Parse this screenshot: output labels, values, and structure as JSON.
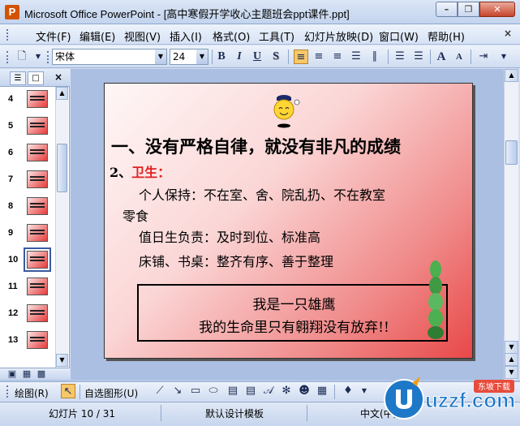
{
  "window": {
    "title": "Microsoft Office PowerPoint - [高中寒假开学收心主题班会ppt课件.ppt]",
    "app_icon": "P",
    "controls": [
      "minimize-icon",
      "restore-icon",
      "close-icon"
    ]
  },
  "menu": {
    "items": [
      "文件(F)",
      "编辑(E)",
      "视图(V)",
      "插入(I)",
      "格式(O)",
      "工具(T)",
      "幻灯片放映(D)",
      "窗口(W)",
      "帮助(H)"
    ],
    "close_glyph": "×"
  },
  "toolbar": {
    "font_name": "宋体",
    "font_size": "24",
    "bold": "B",
    "italic": "I",
    "underline": "U",
    "shadow": "S",
    "grow_font": "A",
    "shrink_font": "A"
  },
  "outline_panel": {
    "close_glyph": "×",
    "slides": [
      {
        "num": "4"
      },
      {
        "num": "5"
      },
      {
        "num": "6"
      },
      {
        "num": "7"
      },
      {
        "num": "8"
      },
      {
        "num": "9"
      },
      {
        "num": "10",
        "selected": true
      },
      {
        "num": "11"
      },
      {
        "num": "12"
      },
      {
        "num": "13"
      }
    ]
  },
  "slide": {
    "title": "一、没有严格自律，就没有非凡的成绩",
    "sub_prefix": "2、",
    "sub_label": "卫生：",
    "line1": "个人保持：不在室、舍、院乱扔、不在教室",
    "line1_cont": "零食",
    "line2": "值日生负责：及时到位、标准高",
    "line3": "床铺、书桌：整齐有序、善于整理",
    "quote1": "我是一只雄鹰",
    "quote2": "我的生命里只有翱翔没有放弃!!"
  },
  "drawing_toolbar": {
    "draw": "绘图(R)",
    "autoshapes": "自选图形(U)"
  },
  "status": {
    "slide": "幻灯片 10 / 31",
    "template": "默认设计模板",
    "language": "中文(中国)"
  },
  "watermark": {
    "brand": "uzzf.com",
    "tagline": "东坡下载"
  },
  "colors": {
    "accent_red": "#e02020",
    "chrome_blue": "#c3d4ee"
  }
}
